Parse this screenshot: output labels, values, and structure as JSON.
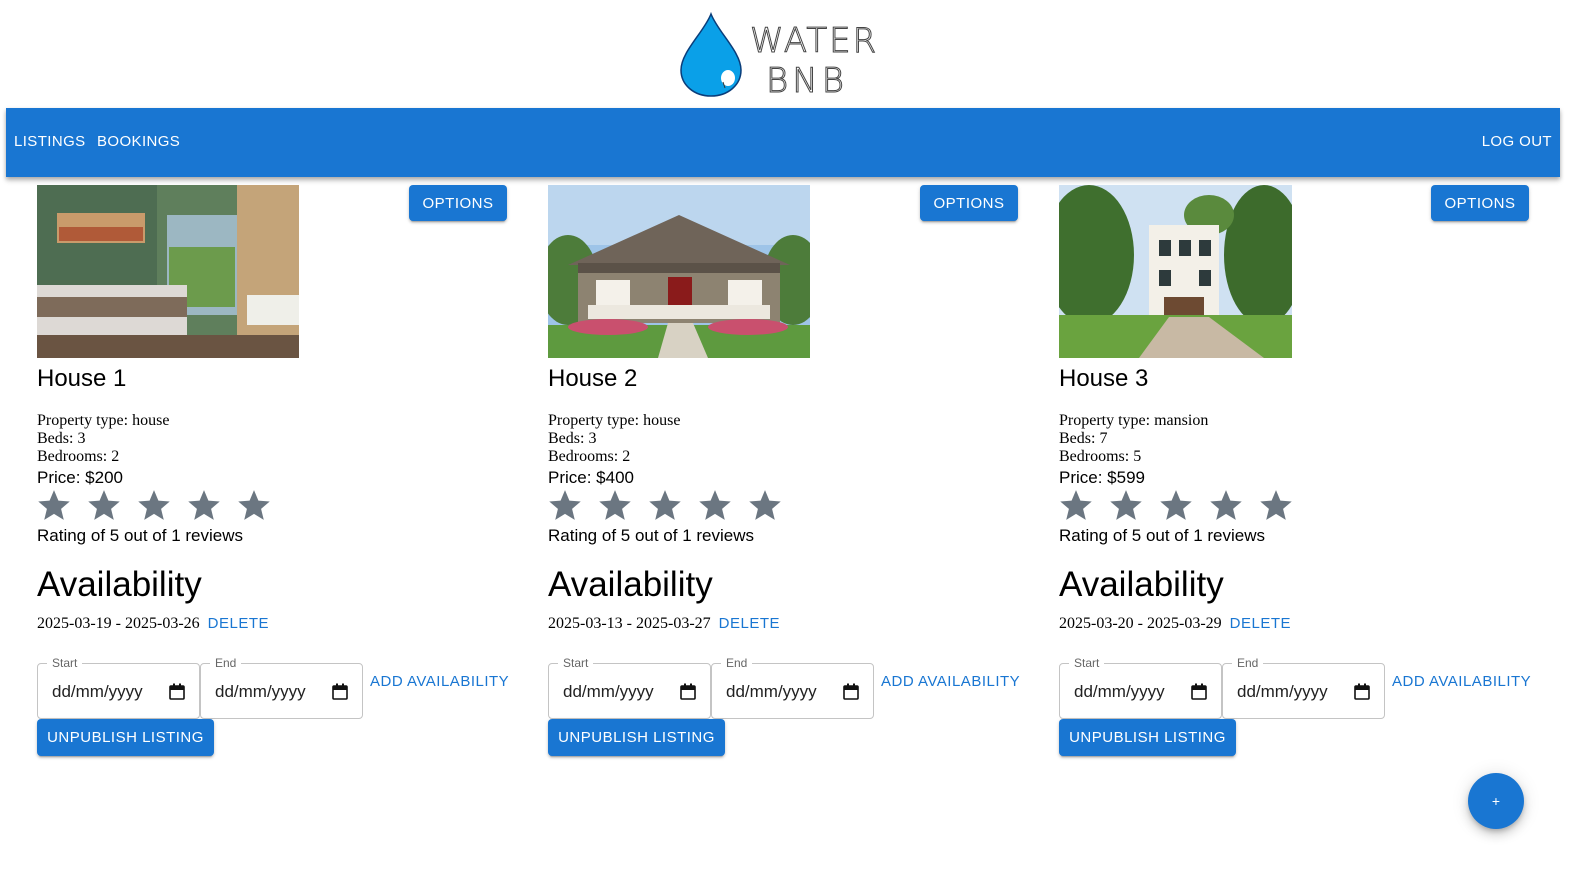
{
  "logo": {
    "line1": "WATER",
    "line2": "BNB",
    "icon": "water-drop-logo"
  },
  "nav": {
    "listings_label": "LISTINGS",
    "bookings_label": "BOOKINGS",
    "logout_label": "LOG OUT",
    "color": "#1976d2"
  },
  "listings": [
    {
      "title": "House 1",
      "options_label": "OPTIONS",
      "property_type": "Property type: house",
      "beds": "Beds: 3",
      "bedrooms": "Bedrooms: 2",
      "price": "Price: $200",
      "rating_stars": 5,
      "rating_text": "Rating of 5 out of 1 reviews",
      "availability_heading": "Availability",
      "availability_range": "2025-03-19 - 2025-03-26",
      "delete_label": "DELETE",
      "start_label": "Start",
      "start_value": "dd/mm/yyyy",
      "end_label": "End",
      "end_value": "dd/mm/yyyy",
      "add_availability_label": "ADD AVAILABILITY",
      "unpublish_label": "UNPUBLISH LISTING",
      "image": "bedroom-photo"
    },
    {
      "title": "House 2",
      "options_label": "OPTIONS",
      "property_type": "Property type: house",
      "beds": "Beds: 3",
      "bedrooms": "Bedrooms: 2",
      "price": "Price: $400",
      "rating_stars": 5,
      "rating_text": "Rating of 5 out of 1 reviews",
      "availability_heading": "Availability",
      "availability_range": "2025-03-13 - 2025-03-27",
      "delete_label": "DELETE",
      "start_label": "Start",
      "start_value": "dd/mm/yyyy",
      "end_label": "End",
      "end_value": "dd/mm/yyyy",
      "add_availability_label": "ADD AVAILABILITY",
      "unpublish_label": "UNPUBLISH LISTING",
      "image": "house-exterior-photo"
    },
    {
      "title": "House 3",
      "options_label": "OPTIONS",
      "property_type": "Property type: mansion",
      "beds": "Beds: 7",
      "bedrooms": "Bedrooms: 5",
      "price": "Price: $599",
      "rating_stars": 5,
      "rating_text": "Rating of 5 out of 1 reviews",
      "availability_heading": "Availability",
      "availability_range": "2025-03-20 - 2025-03-29",
      "delete_label": "DELETE",
      "start_label": "Start",
      "start_value": "dd/mm/yyyy",
      "end_label": "End",
      "end_value": "dd/mm/yyyy",
      "add_availability_label": "ADD AVAILABILITY",
      "unpublish_label": "UNPUBLISH LISTING",
      "image": "mansion-photo"
    }
  ],
  "fab": {
    "label": "+"
  },
  "colors": {
    "primary": "#1976d2",
    "star": "#6b7681"
  }
}
